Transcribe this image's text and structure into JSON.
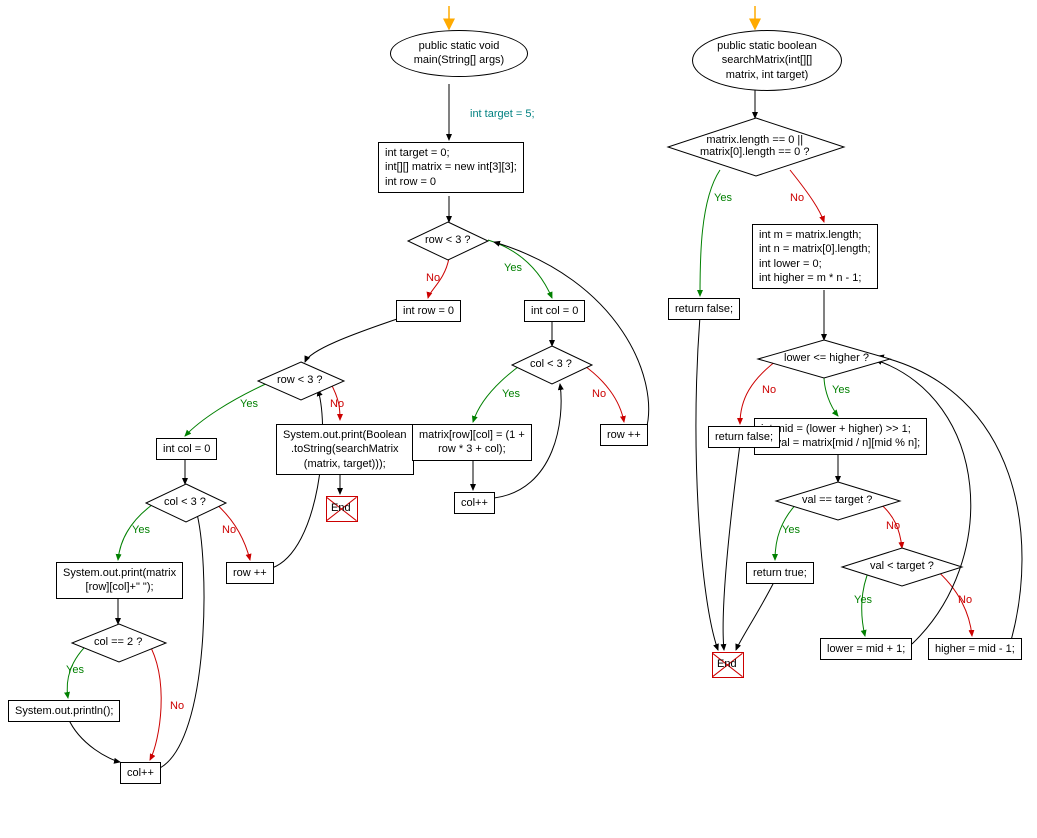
{
  "yes": "Yes",
  "no": "No",
  "end": "End",
  "left": {
    "start": "public static void\nmain(String[] args)",
    "comment": "int target = 5;",
    "init": "int target = 0;\nint[][] matrix = new int[3][3];\nint row = 0",
    "row_lt_3": "row < 3 ?",
    "int_row_0_b": "int row = 0",
    "int_col_0": "int col = 0",
    "row_lt_3_b": "row < 3 ?",
    "col_lt_3": "col < 3 ?",
    "print_bool": "System.out.print(Boolean\n.toString(searchMatrix\n(matrix, target)));",
    "matrix_assign": "matrix[row][col] = (1 +\nrow * 3 + col);",
    "row_pp": "row ++",
    "col_pp_a": "col++",
    "int_col_0_b": "int col = 0",
    "col_lt_3_b": "col < 3 ?",
    "row_pp_b": "row ++",
    "print_matrix": "System.out.print(matrix\n[row][col]+\" \");",
    "col_eq_2": "col == 2 ?",
    "println": "System.out.println();",
    "col_pp_b": "col++"
  },
  "right": {
    "start": "public static boolean\nsearchMatrix(int[][]\nmatrix, int target)",
    "len_check": "matrix.length == 0 ||\nmatrix[0].length == 0 ?",
    "init_vars": "int m = matrix.length;\nint n = matrix[0].length;\nint lower = 0;\nint higher = m * n - 1;",
    "return_false_a": "return false;",
    "lower_le_higher": "lower <= higher ?",
    "mid_calc": "int mid = (lower + higher) >> 1;\nint val = matrix[mid / n][mid % n];",
    "return_false_b": "return false;",
    "val_eq_target": "val == target ?",
    "return_true": "return true;",
    "val_lt_target": "val < target ?",
    "lower_assign": "lower = mid + 1;",
    "higher_assign": "higher = mid - 1;"
  }
}
